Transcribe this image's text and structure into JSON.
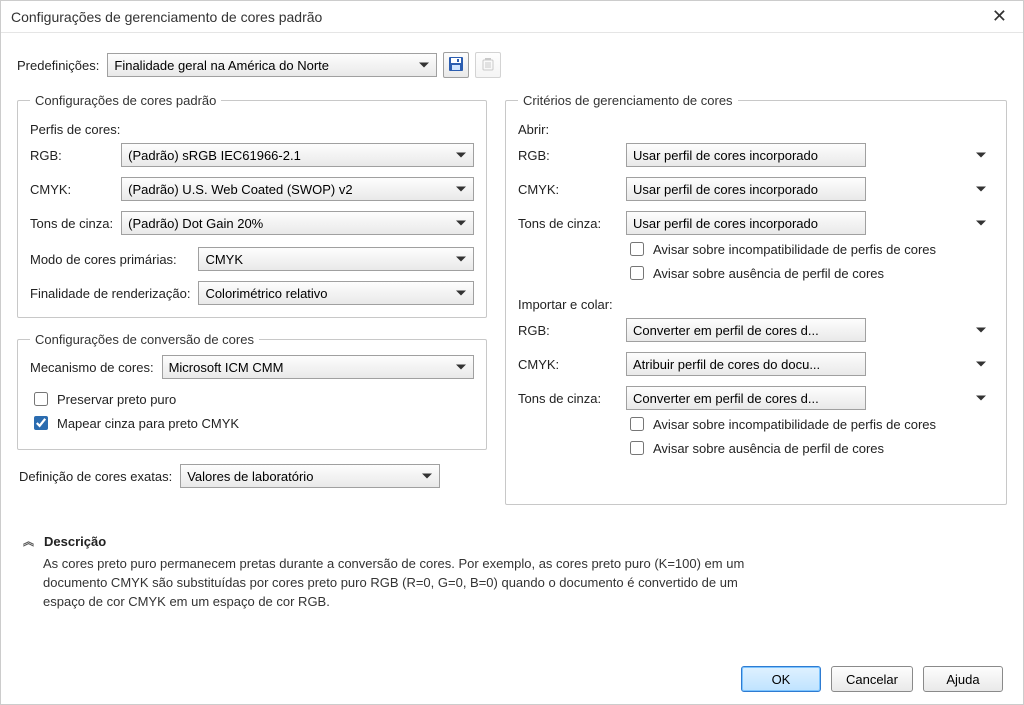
{
  "window_title": "Configurações de gerenciamento de cores padrão",
  "presets": {
    "label": "Predefinições:",
    "value": "Finalidade geral na América do Norte"
  },
  "group_default": {
    "legend": "Configurações de cores padrão",
    "profiles_label": "Perfis de cores:",
    "rgb_label": "RGB:",
    "rgb_value": "(Padrão) sRGB IEC61966-2.1",
    "cmyk_label": "CMYK:",
    "cmyk_value": "(Padrão) U.S. Web Coated (SWOP) v2",
    "gray_label": "Tons de cinza:",
    "gray_value": "(Padrão) Dot Gain 20%",
    "primary_mode_label": "Modo de cores primárias:",
    "primary_mode_value": "CMYK",
    "rendering_label": "Finalidade de renderização:",
    "rendering_value": "Colorimétrico relativo"
  },
  "group_conversion": {
    "legend": "Configurações de conversão de cores",
    "engine_label": "Mecanismo de cores:",
    "engine_value": "Microsoft ICM CMM",
    "preserve_black": "Preservar preto puro",
    "map_gray": "Mapear cinza para preto CMYK"
  },
  "exact": {
    "label": "Definição de cores exatas:",
    "value": "Valores de laboratório"
  },
  "group_policies": {
    "legend": "Critérios de gerenciamento de cores",
    "open_label": "Abrir:",
    "rgb_label": "RGB:",
    "cmyk_label": "CMYK:",
    "gray_label": "Tons de cinza:",
    "open_rgb": "Usar perfil de cores incorporado",
    "open_cmyk": "Usar perfil de cores incorporado",
    "open_gray": "Usar perfil de cores incorporado",
    "warn_mismatch": "Avisar sobre incompatibilidade de perfis de cores",
    "warn_missing": "Avisar sobre ausência de perfil de cores",
    "import_label": "Importar e colar:",
    "import_rgb": "Converter em perfil de cores d...",
    "import_cmyk": "Atribuir perfil de cores do docu...",
    "import_gray": "Converter em perfil de cores d..."
  },
  "description": {
    "heading": "Descrição",
    "body": "As cores preto puro permanecem pretas durante a conversão de cores. Por exemplo, as cores preto puro (K=100) em um documento CMYK são substituídas por cores preto puro RGB (R=0, G=0, B=0) quando o documento é convertido de um espaço de cor CMYK em um espaço de cor RGB."
  },
  "buttons": {
    "ok": "OK",
    "cancel": "Cancelar",
    "help": "Ajuda"
  }
}
